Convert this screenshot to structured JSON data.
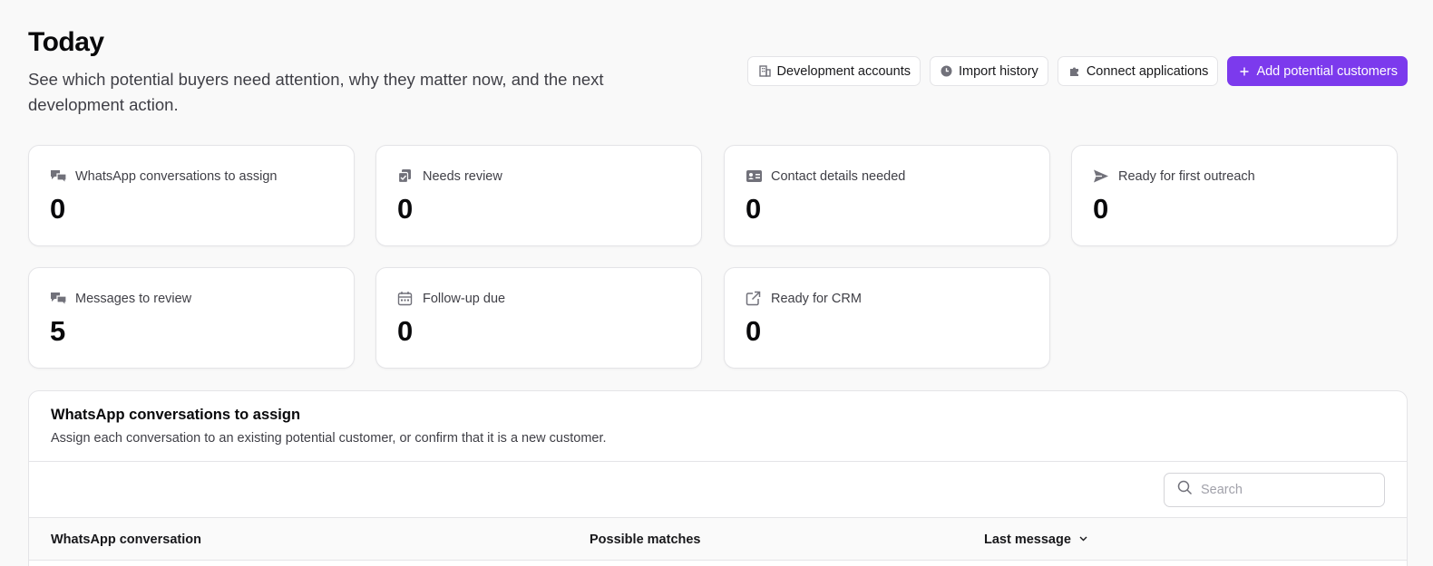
{
  "header": {
    "title": "Today",
    "subtitle": "See which potential buyers need attention, why they matter now, and the next development action."
  },
  "actions": {
    "development_accounts": "Development accounts",
    "import_history": "Import history",
    "connect_applications": "Connect applications",
    "add_potential_customers": "Add potential customers"
  },
  "cards": [
    {
      "label": "WhatsApp conversations to assign",
      "value": "0",
      "icon": "chat-bubbles-icon"
    },
    {
      "label": "Needs review",
      "value": "0",
      "icon": "review-copy-icon"
    },
    {
      "label": "Contact details needed",
      "value": "0",
      "icon": "contact-card-icon"
    },
    {
      "label": "Ready for first outreach",
      "value": "0",
      "icon": "send-icon"
    },
    {
      "label": "Messages to review",
      "value": "5",
      "icon": "chat-bubbles-icon"
    },
    {
      "label": "Follow-up due",
      "value": "0",
      "icon": "calendar-icon"
    },
    {
      "label": "Ready for CRM",
      "value": "0",
      "icon": "external-link-icon"
    }
  ],
  "panel": {
    "title": "WhatsApp conversations to assign",
    "description": "Assign each conversation to an existing potential customer, or confirm that it is a new customer.",
    "search_placeholder": "Search",
    "columns": [
      "WhatsApp conversation",
      "Possible matches",
      "Last message"
    ]
  },
  "colors": {
    "accent": "#7c3aed",
    "background": "#f9f9f9",
    "border": "#e4e4e7"
  }
}
